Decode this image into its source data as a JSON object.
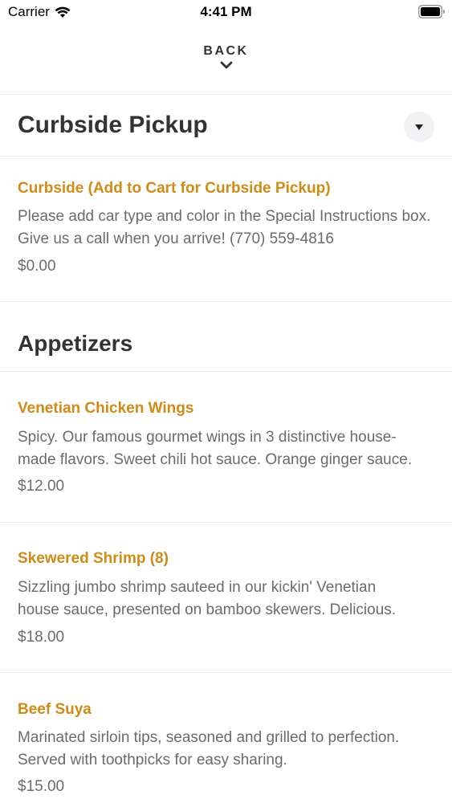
{
  "status_bar": {
    "carrier": "Carrier",
    "time": "4:41 PM"
  },
  "nav": {
    "back_label": "BACK",
    "back_icon": "chevron-down-icon"
  },
  "sections": [
    {
      "title": "Curbside Pickup",
      "toggle_icon": "caret-down-icon"
    },
    {
      "title": "Appetizers"
    }
  ],
  "items": [
    {
      "name": "Curbside (Add to Cart for Curbside Pickup)",
      "desc": "Please add car type and color in the Special Instructions box. Give us a call when you arrive! (770) 559-4816",
      "price": "$0.00"
    },
    {
      "name": "Venetian Chicken Wings",
      "desc": "Spicy. Our famous gourmet wings in 3 distinctive house-made flavors. Sweet chili hot sauce. Orange ginger sauce.",
      "price": "$12.00"
    },
    {
      "name": "Skewered Shrimp (8)",
      "desc": "Sizzling jumbo shrimp sauteed in our kickin' Venetian house sauce, presented on bamboo skewers. Delicious.",
      "price": "$18.00"
    },
    {
      "name": "Beef Suya",
      "desc": "Marinated sirloin tips, seasoned and grilled to perfection. Served with toothpicks for easy sharing.",
      "price": "$15.00"
    }
  ],
  "colors": {
    "accent": "#d08a16",
    "text": "#333333",
    "muted": "#6b6b6b",
    "divider": "#ececec"
  }
}
